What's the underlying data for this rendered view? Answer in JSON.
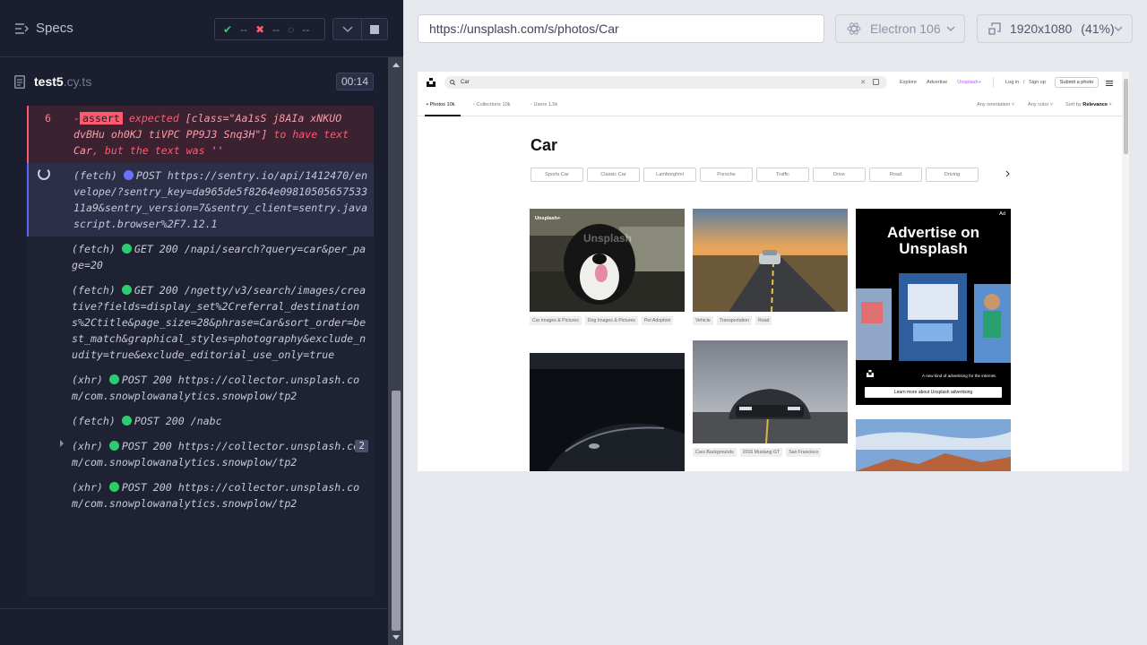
{
  "runner": {
    "specs_label": "Specs",
    "stats": {
      "passed": "--",
      "failed": "--",
      "pending": "--"
    },
    "file": {
      "name": "test5",
      "ext": ".cy.ts",
      "duration": "00:14"
    },
    "log": {
      "error": {
        "number": "6",
        "dash": "-",
        "tag": "assert",
        "keyword": "expected",
        "selector": "[class=\"Aa1sS j8AIa xNKUO dvBHu oh0KJ tiVPC PP9J3 Snq3H\"]",
        "have": "to have text",
        "text_value": "Car",
        "but": ", but the text was",
        "actual": "''"
      },
      "entries": [
        {
          "kind": "(fetch)",
          "method": "POST",
          "url": "https://sentry.io/api/1412470/envelope/?sentry_key=da965de5f8264e0981050565753311a9&sentry_version=7&sentry_client=sentry.javascript.browser%2F7.12.1",
          "status": "pending"
        },
        {
          "kind": "(fetch)",
          "method": "GET 200",
          "url": "/napi/search?query=car&per_page=20",
          "status": "ok"
        },
        {
          "kind": "(fetch)",
          "method": "GET 200",
          "url": "/ngetty/v3/search/images/creative?fields=display_set%2Creferral_destinations%2Ctitle&page_size=28&phrase=Car&sort_order=best_match&graphical_styles=photography&exclude_nudity=true&exclude_editorial_use_only=true",
          "status": "ok"
        },
        {
          "kind": "(xhr)",
          "method": "POST 200",
          "url": "https://collector.unsplash.com/com.snowplowanalytics.snowplow/tp2",
          "status": "ok"
        },
        {
          "kind": "(fetch)",
          "method": "POST 200",
          "url": "/nabc",
          "status": "ok"
        },
        {
          "kind": "(xhr)",
          "method": "POST 200",
          "url": "https://collector.unsplash.com/com.snowplowanalytics.snowplow/tp2",
          "status": "ok",
          "count": "2"
        },
        {
          "kind": "(xhr)",
          "method": "POST 200",
          "url": "https://collector.unsplash.com/com.snowplowanalytics.snowplow/tp2",
          "status": "ok"
        }
      ]
    }
  },
  "preview": {
    "url": "https://unsplash.com/s/photos/Car",
    "browser": "Electron 106",
    "viewport": "1920x1080",
    "scale": "(41%)"
  },
  "site": {
    "search_value": "Car",
    "nav": [
      "Explore",
      "Advertise",
      "Unsplash+"
    ],
    "login": "Log in",
    "slash": "/",
    "signup": "Sign up",
    "submit": "Submit a photo",
    "tabs": [
      {
        "label": "Photos 10k"
      },
      {
        "label": "Collections 10k"
      },
      {
        "label": "Users 1.5k"
      }
    ],
    "orientation": "Any orientation",
    "color": "Any color",
    "sort_prefix": "Sort by",
    "sort_value": "Relevance",
    "heading": "Car",
    "chips": [
      "Sports Car",
      "Classic Car",
      "Lamborghini",
      "Porsche",
      "Traffic",
      "Drive",
      "Road",
      "Driving"
    ],
    "captions_1": [
      "Car Images & Pictures",
      "Dog Images & Pictures",
      "Pet Adoption"
    ],
    "captions_2": [
      "Vehicle",
      "Transportation",
      "Road"
    ],
    "captions_3": [
      "Cars Backgrounds",
      "2016 Mustang GT",
      "San Francisco"
    ],
    "unsplash_plus": "Unsplash+",
    "watermark": "Unsplash",
    "ad": {
      "tag": "Ad",
      "title": "Advertise on Unsplash",
      "tagline": "A new kind of advertising for the internet.",
      "button": "Learn more about Unsplash advertising"
    }
  }
}
